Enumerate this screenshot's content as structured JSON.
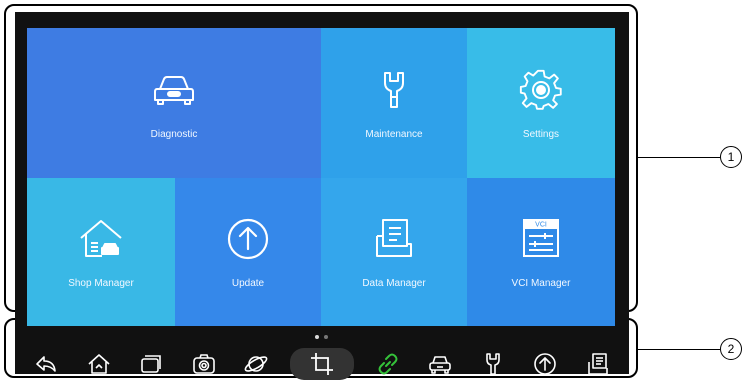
{
  "tiles": [
    {
      "label": "Diagnostic",
      "icon": "car-front-icon"
    },
    {
      "label": "Maintenance",
      "icon": "wrench-icon"
    },
    {
      "label": "Settings",
      "icon": "gear-icon"
    },
    {
      "label": "Shop Manager",
      "icon": "house-car-icon"
    },
    {
      "label": "Update",
      "icon": "up-arrow-circle-icon"
    },
    {
      "label": "Data Manager",
      "icon": "document-tray-icon"
    },
    {
      "label": "VCI Manager",
      "icon": "vci-module-icon",
      "badge": "VCI"
    }
  ],
  "taskbar": [
    "back-icon",
    "home-icon",
    "recent-apps-icon",
    "camera-icon",
    "browser-icon",
    "crop-icon",
    "link-icon",
    "car-icon",
    "wrench-icon",
    "update-icon",
    "document-icon"
  ],
  "page_indicator": {
    "pages": 2,
    "current": 1
  },
  "callouts": {
    "one": "1",
    "two": "2"
  },
  "colors": {
    "link_icon": "#35c23a",
    "diagnostic_tile": "#3e7ce3",
    "settings_tile": "#38bce8"
  }
}
